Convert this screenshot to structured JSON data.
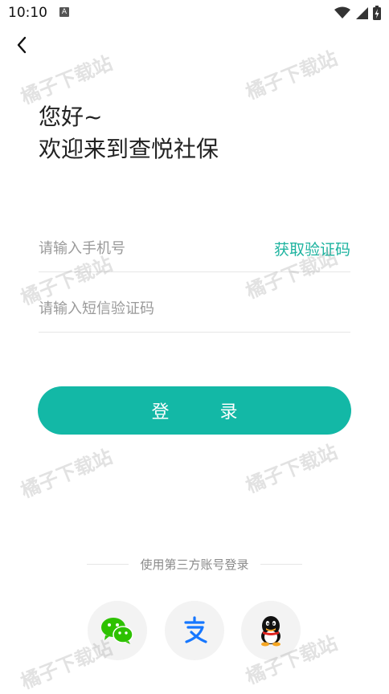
{
  "status_bar": {
    "time": "10:10",
    "notification_badge": "A"
  },
  "greeting": {
    "line1": "您好~",
    "line2": "欢迎来到查悦社保"
  },
  "phone_input": {
    "placeholder": "请输入手机号",
    "value": ""
  },
  "get_code_label": "获取验证码",
  "code_input": {
    "placeholder": "请输入短信验证码",
    "value": ""
  },
  "login_button_label": "登 录",
  "third_party_label": "使用第三方账号登录",
  "social": [
    {
      "name": "wechat",
      "icon": "wechat-icon"
    },
    {
      "name": "alipay",
      "icon": "alipay-icon",
      "glyph": "支"
    },
    {
      "name": "qq",
      "icon": "qq-icon"
    }
  ],
  "watermark_text": "橘子下载站",
  "colors": {
    "accent": "#13b8a6",
    "accent_text": "#1db39f",
    "wechat": "#2dc100",
    "alipay": "#1677ff"
  }
}
